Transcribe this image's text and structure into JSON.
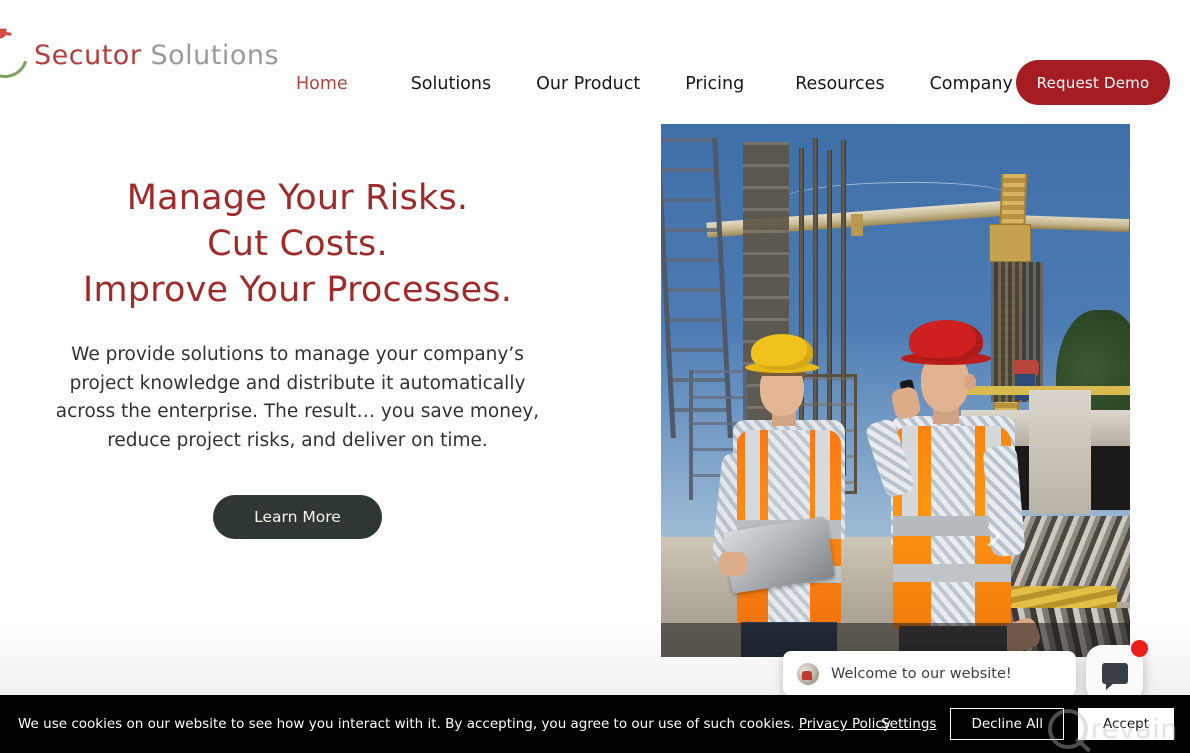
{
  "brand": {
    "word1": "Secutor",
    "word2": "Solutions",
    "logo_icon": "leaf-circle-logo-icon"
  },
  "nav": {
    "items": [
      {
        "label": "Home",
        "active": true
      },
      {
        "label": "Solutions",
        "active": false
      },
      {
        "label": "Our Product",
        "active": false
      },
      {
        "label": "Pricing",
        "active": false
      },
      {
        "label": "Resources",
        "active": false
      },
      {
        "label": "Company",
        "active": false
      }
    ],
    "cta_label": "Request Demo"
  },
  "hero": {
    "title_line1": "Manage Your Risks.",
    "title_line2": "Cut Costs.",
    "title_line3": "Improve Your Processes.",
    "paragraph": "We provide solutions to manage your company’s project knowledge and distribute it automatically across the enterprise. The result… you save money, reduce project risks, and deliver on time.",
    "cta_label": "Learn More",
    "slider_next_icon": "chevron-right-icon",
    "image_alt": "two-construction-workers-with-hardhats-reviewing-tablet-on-site"
  },
  "chat": {
    "message": "Welcome to our website!",
    "avatar_icon": "agent-avatar-icon",
    "launcher_icon": "chat-bubble-icon",
    "badge_color": "#f01b1b"
  },
  "cookie": {
    "message": "We use cookies on our website to see how you interact with it. By accepting, you agree to our use of such cookies.",
    "privacy_link": "Privacy Policy",
    "settings_label": "Settings",
    "decline_label": "Decline All",
    "accept_label": "Accept"
  },
  "watermark": {
    "text": "revain",
    "icon": "revain-logo-icon"
  },
  "colors": {
    "brand_red": "#b13f3f",
    "cta_red": "#a51d22",
    "headline_red": "#9e2a2a",
    "dark_button": "#2f3734",
    "cookie_bar": "#000000",
    "nav_active": "#b0443f"
  }
}
